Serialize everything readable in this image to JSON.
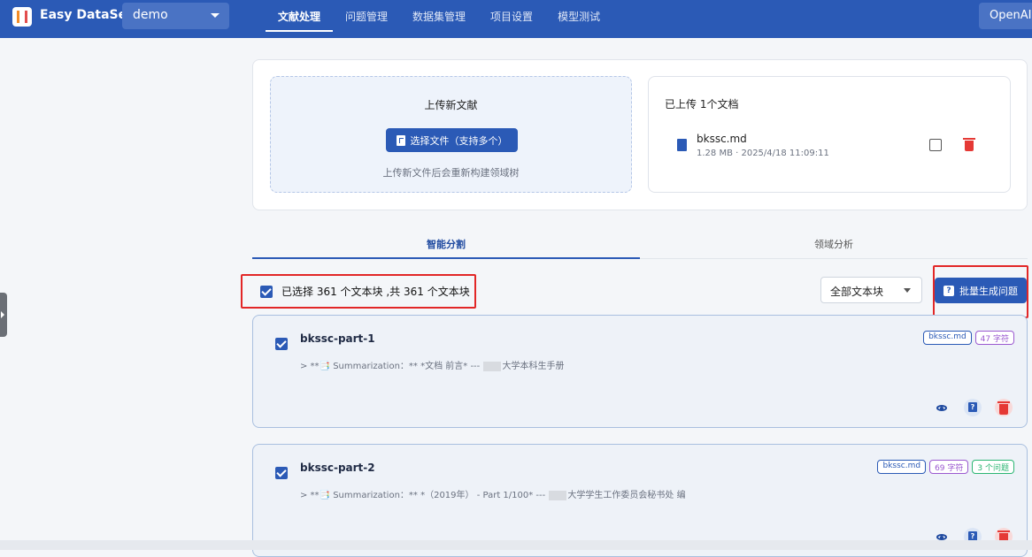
{
  "header": {
    "app_title": "Easy DataSet",
    "project": "demo",
    "tabs": [
      "文献处理",
      "问题管理",
      "数据集管理",
      "项目设置",
      "模型测试"
    ],
    "active_tab": "文献处理",
    "provider": "OpenAI:"
  },
  "upload": {
    "title": "上传新文献",
    "button_label": "选择文件（支持多个）",
    "note": "上传新文件后会重新构建领域树"
  },
  "uploaded": {
    "title": "已上传 1个文档",
    "file": {
      "name": "bkssc.md",
      "meta": "1.28 MB · 2025/4/18 11:09:11"
    }
  },
  "tabs": {
    "split": "智能分割",
    "domain": "领域分析"
  },
  "toolbar": {
    "selection_text": "已选择 361 个文本块 ,共 361 个文本块",
    "filter": "全部文本块",
    "batch_label": "批量生成问题"
  },
  "chunks": [
    {
      "title": "bkssc-part-1",
      "summary_prefix": "> **📑 Summarization：** *文档 前言* --- ",
      "summary_suffix": "大学本科生手册",
      "file_tag": "bkssc.md",
      "chars_tag": "47 字符"
    },
    {
      "title": "bkssc-part-2",
      "summary_prefix": "> **📑 Summarization：** *（2019年） - Part 1/100* --- ",
      "summary_suffix": "大学学生工作委员会秘书处 编",
      "file_tag": "bkssc.md",
      "chars_tag": "69 字符",
      "questions_tag": "3 个问题"
    }
  ]
}
